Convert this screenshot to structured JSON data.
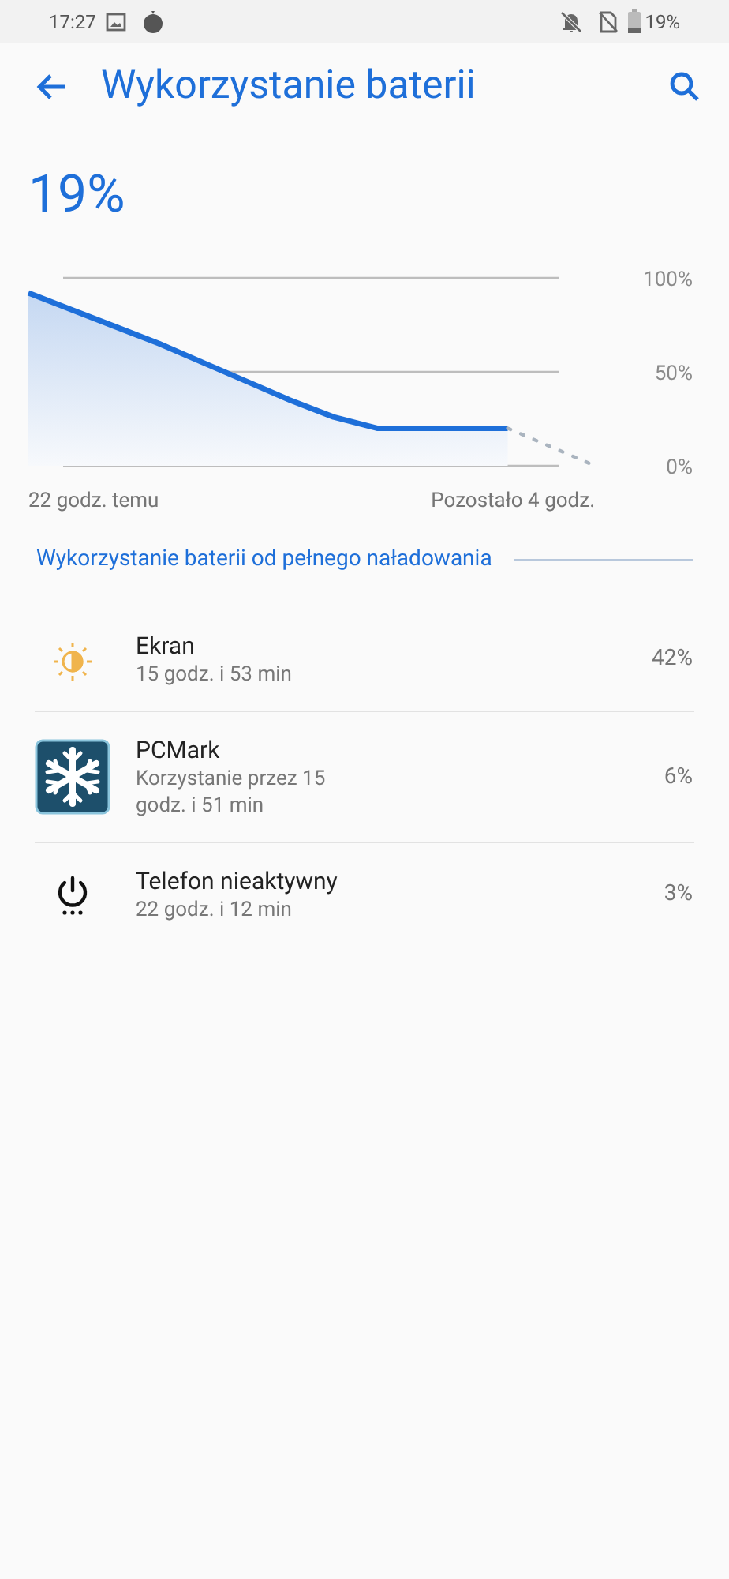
{
  "status_bar": {
    "time": "17:27",
    "battery": "19%"
  },
  "header": {
    "title": "Wykorzystanie baterii"
  },
  "battery_level": "19%",
  "history_graph": {
    "y_labels": [
      "100%",
      "50%",
      "0%"
    ],
    "x_labels": [
      "22 godz. temu",
      "Pozostało 4 godz."
    ]
  },
  "section_title": "Wykorzystanie baterii od pełnego naładowania",
  "items": [
    {
      "kind": "screen",
      "name": "Ekran",
      "detail": "15 godz. i 53 min",
      "percent": "42%"
    },
    {
      "kind": "app",
      "name": "PCMark",
      "detail": "Korzystanie przez 15 godz. i 51 min",
      "percent": "6%"
    },
    {
      "kind": "idle",
      "name": "Telefon nieaktywny",
      "detail": "22 godz. i 12 min",
      "percent": "3%"
    }
  ]
}
